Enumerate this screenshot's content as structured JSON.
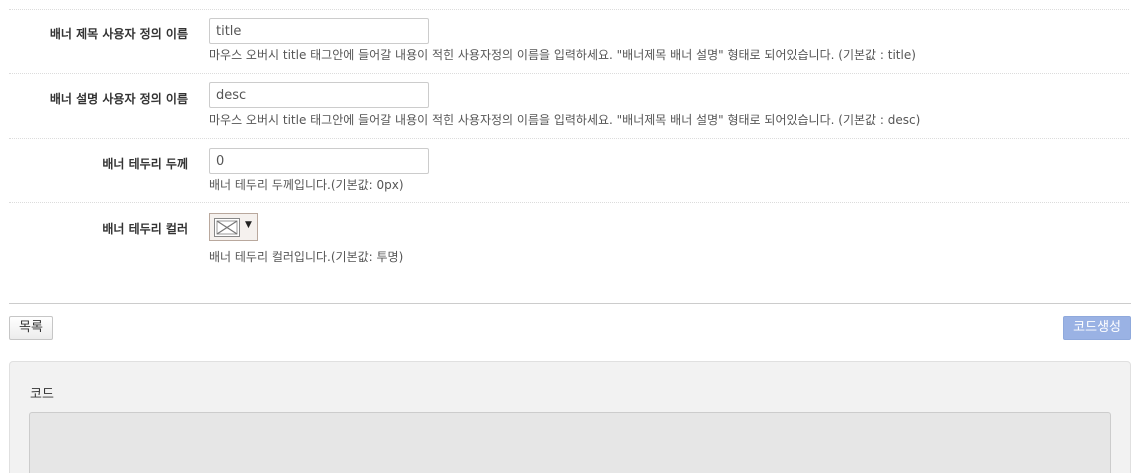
{
  "fields": [
    {
      "label": "배너 제목 사용자 정의 이름",
      "value": "title",
      "help": "마우스 오버시 title 태그안에 들어갈 내용이 적힌 사용자정의 이름을 입력하세요. \"배너제목 배너 설명\" 형태로 되어있습니다. (기본값 : title)"
    },
    {
      "label": "배너 설명 사용자 정의 이름",
      "value": "desc",
      "help": "마우스 오버시 title 태그안에 들어갈 내용이 적힌 사용자정의 이름을 입력하세요. \"배너제목 배너 설명\" 형태로 되어있습니다. (기본값 : desc)"
    },
    {
      "label": "배너 테두리 두께",
      "value": "0",
      "help": "배너 테두리 두께입니다.(기본값: 0px)"
    },
    {
      "label": "배너 테두리 컬러",
      "help": "배너 테두리 컬러입니다.(기본값: 투명)"
    }
  ],
  "buttons": {
    "list": "목록",
    "generate": "코드생성"
  },
  "code": {
    "title": "코드",
    "value": ""
  },
  "colors": {
    "accent_button": "#9ab2e4",
    "color_picker_border": "#b9a89d"
  }
}
